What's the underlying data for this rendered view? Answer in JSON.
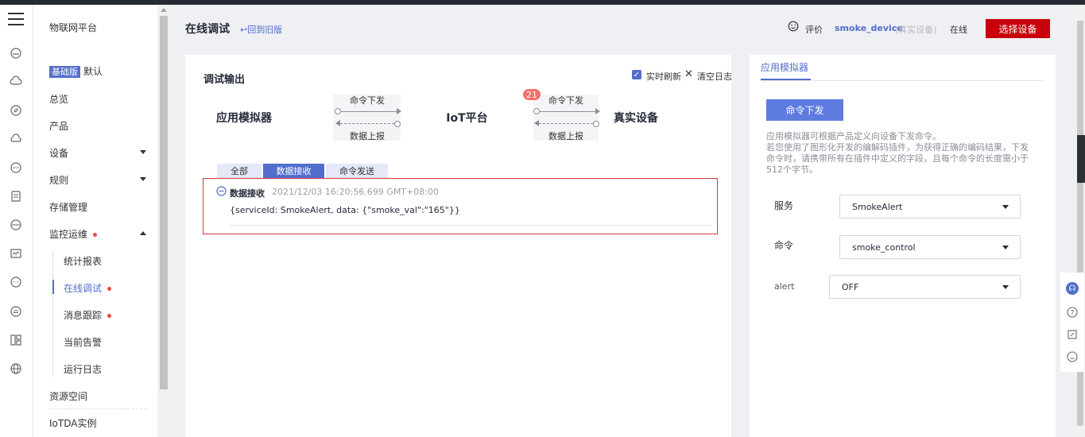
{
  "nav": {
    "brand": "物联网平台",
    "edition_badge": "基础版",
    "edition_name": "默认",
    "items": {
      "overview": "总览",
      "product": "产品",
      "device": "设备",
      "rules": "规则",
      "storage": "存储管理",
      "monitor": "监控运维",
      "stats": "统计报表",
      "online_debug": "在线调试",
      "msg_trace": "消息跟踪",
      "alarms": "当前告警",
      "run_log": "运行日志",
      "resource": "资源空间",
      "iotda": "IoTDA实例"
    }
  },
  "header": {
    "title": "在线调试",
    "back_link": "↩回到旧版",
    "rate": "评价",
    "device_name": "smoke_device",
    "device_type": "(真实设备)",
    "status": "在线",
    "select_device_btn": "选择设备"
  },
  "debug": {
    "title": "调试输出",
    "realtime_refresh": "实时刷新",
    "clear_log": "清空日志",
    "flow": {
      "app_sim": "应用模拟器",
      "iot_platform": "IoT平台",
      "real_device": "真实设备",
      "cmd_down": "命令下发",
      "data_up": "数据上报",
      "pending_count": "21"
    },
    "tabs": [
      "全部",
      "数据接收",
      "命令发送"
    ],
    "log": {
      "type": "数据接收",
      "time": "2021/12/03 16:20:56.699 GMT+08:00",
      "payload": "{serviceId: SmokeAlert, data: {\"smoke_val\":\"165\"}}"
    }
  },
  "simulator": {
    "tab": "应用模拟器",
    "cmd_btn": "命令下发",
    "desc1": "应用模拟器可根据产品定义向设备下发命令。",
    "desc2": "若您使用了图形化开发的编解码插件，为获得正确的编码结果，下发命令时，请携带所有在插件中定义的字段，且每个命令的长度需小于512个字节。",
    "service_label": "服务",
    "service_value": "SmokeAlert",
    "command_label": "命令",
    "command_value": "smoke_control",
    "alert_label": "alert",
    "alert_value": "OFF"
  },
  "colors": {
    "primary": "#526ecc",
    "danger": "#c7000b",
    "badge": "#f66f6a"
  }
}
